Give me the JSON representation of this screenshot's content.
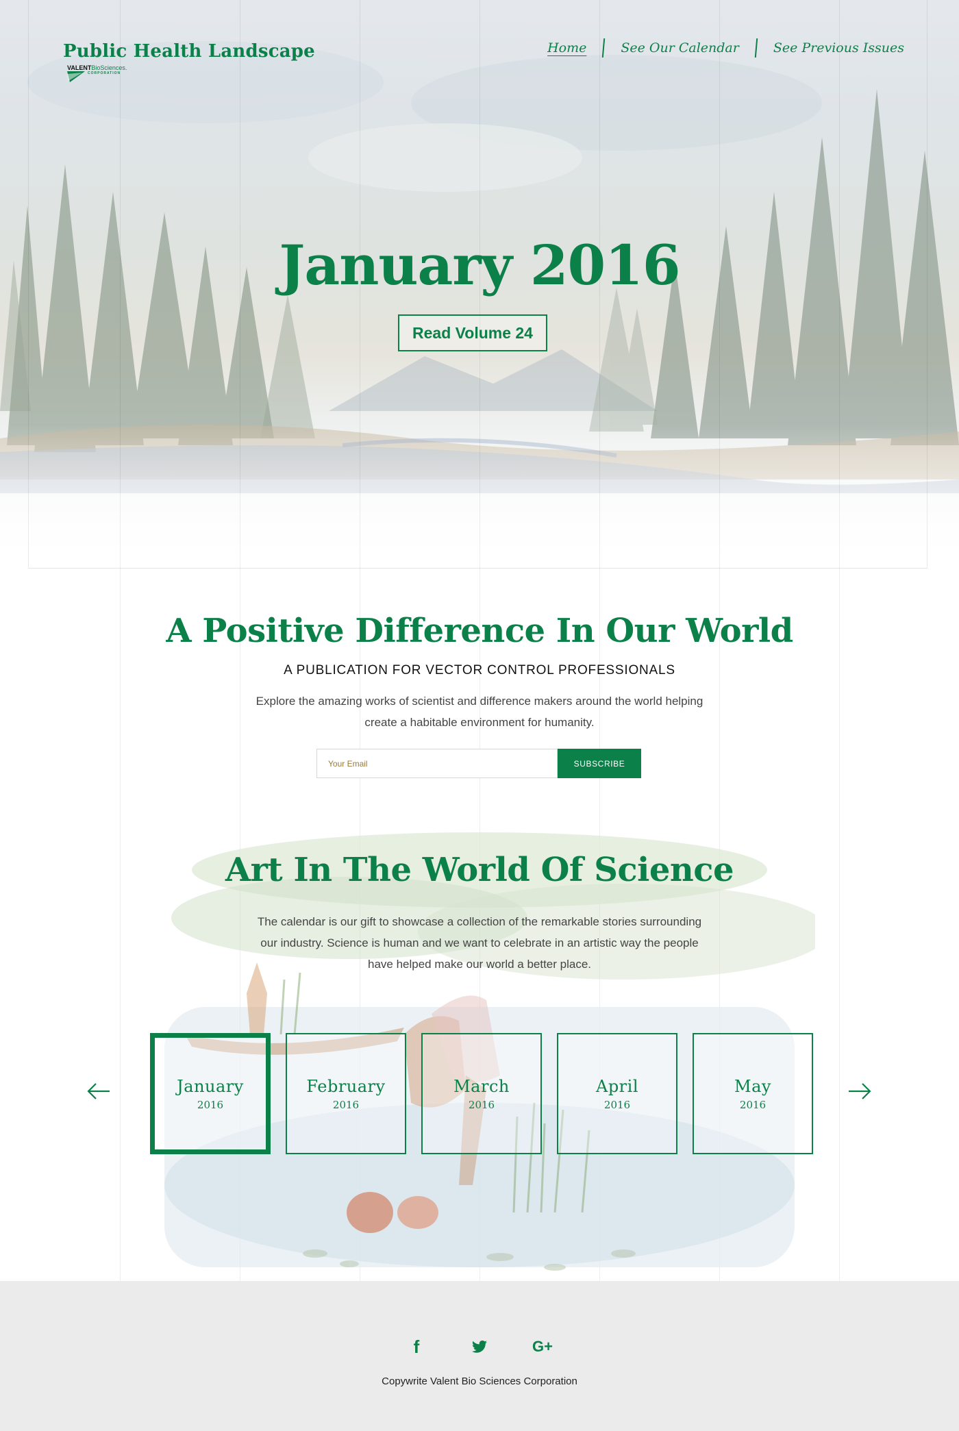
{
  "brand": {
    "title": "Public Health Landscape",
    "sub_strong": "VALENT",
    "sub_name": "BioSciences.",
    "sub_corp": "CORPORATION",
    "color": "#0c8049"
  },
  "nav": {
    "items": [
      {
        "label": "Home",
        "active": true
      },
      {
        "label": "See Our Calendar",
        "active": false
      },
      {
        "label": "See Previous Issues",
        "active": false
      }
    ]
  },
  "hero": {
    "title": "January 2016",
    "button_label": "Read Volume 24"
  },
  "intro": {
    "title": "A Positive Difference In Our World",
    "subtitle": "A PUBLICATION FOR VECTOR CONTROL PROFESSIONALS",
    "text_line1": "Explore the amazing works of scientist and difference makers around the world helping",
    "text_line2": "create a habitable environment for humanity.",
    "email_placeholder": "Your Email",
    "subscribe_label": "SUBSCRIBE"
  },
  "art": {
    "title": "Art In The World Of Science",
    "text_line1": "The calendar is our gift to showcase a collection of the remarkable stories surrounding",
    "text_line2": "our industry. Science is human and we want to celebrate in an artistic way the people",
    "text_line3": "have helped make our world a better place.",
    "months": [
      {
        "month": "January",
        "year": "2016",
        "active": true
      },
      {
        "month": "February",
        "year": "2016",
        "active": false
      },
      {
        "month": "March",
        "year": "2016",
        "active": false
      },
      {
        "month": "April",
        "year": "2016",
        "active": false
      },
      {
        "month": "May",
        "year": "2016",
        "active": false
      }
    ],
    "prev_icon": "arrow-left-icon",
    "next_icon": "arrow-right-icon"
  },
  "footer": {
    "social": [
      {
        "icon": "facebook-icon",
        "glyph": "f"
      },
      {
        "icon": "twitter-icon",
        "glyph": ""
      },
      {
        "icon": "google-plus-icon",
        "glyph": "G+"
      }
    ],
    "copyright": "Copywrite Valent Bio Sciences Corporation"
  }
}
